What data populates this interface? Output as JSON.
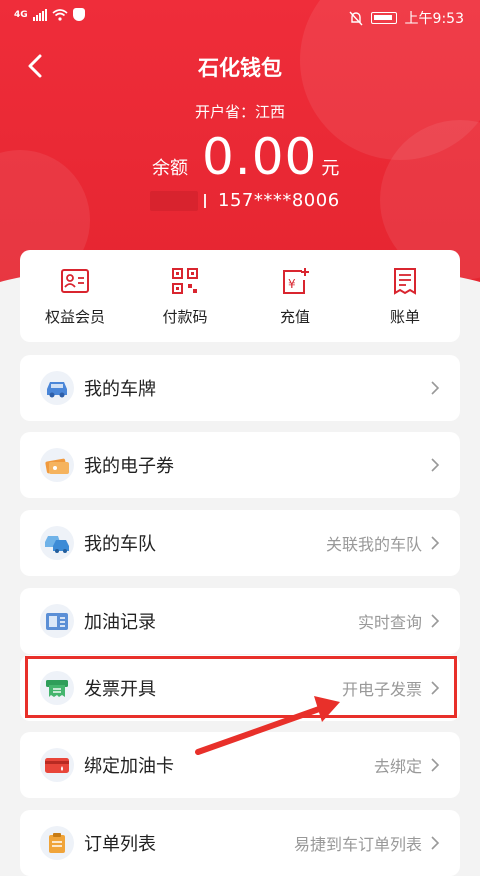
{
  "status_bar": {
    "network": "4G",
    "time": "上午9:53"
  },
  "header": {
    "title": "石化钱包",
    "province": "开户省：江西",
    "balance_label": "余额",
    "balance_amount": "0.00",
    "balance_unit": "元",
    "phone": "157****8006"
  },
  "quick_actions": [
    {
      "label": "权益会员",
      "icon": "member-card-icon"
    },
    {
      "label": "付款码",
      "icon": "qr-code-icon"
    },
    {
      "label": "充值",
      "icon": "recharge-icon"
    },
    {
      "label": "账单",
      "icon": "bill-icon"
    }
  ],
  "menu": [
    {
      "title": "我的车牌",
      "hint": "",
      "icon": "car-icon"
    },
    {
      "title": "我的电子券",
      "hint": "",
      "icon": "coupon-icon"
    },
    {
      "title": "我的车队",
      "hint": "关联我的车队",
      "icon": "fleet-icon"
    },
    {
      "title": "加油记录",
      "hint": "实时查询",
      "icon": "fuel-record-icon"
    },
    {
      "title": "发票开具",
      "hint": "开电子发票",
      "icon": "invoice-icon"
    },
    {
      "title": "绑定加油卡",
      "hint": "去绑定",
      "icon": "fuel-card-icon"
    },
    {
      "title": "订单列表",
      "hint": "易捷到车订单列表",
      "icon": "order-list-icon"
    }
  ],
  "colors": {
    "brand_red": "#e8252f",
    "highlight": "#e8302a"
  }
}
